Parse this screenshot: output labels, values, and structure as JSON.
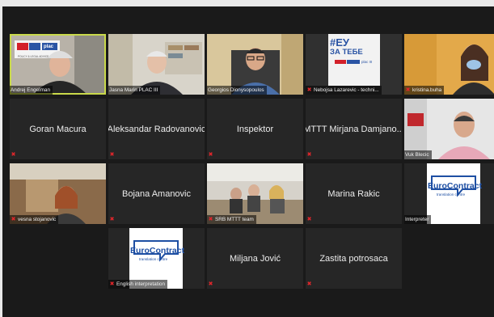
{
  "meeting": {
    "tiles": [
      {
        "name": "Andrej Engelman",
        "muted": false,
        "active": true
      },
      {
        "name": "Jasna Marin PLAC III",
        "muted": false
      },
      {
        "name": "Georgios Dionysopoulos",
        "muted": false
      },
      {
        "name": "Nebojsa Lazarevic - techni...",
        "muted": true
      },
      {
        "name": "kristina.buha",
        "muted": true
      },
      {
        "name": "Goran Macura",
        "muted": true
      },
      {
        "name": "Aleksandar Radovanovic",
        "muted": true
      },
      {
        "name": "Inspektor",
        "muted": true
      },
      {
        "name": "MTTT Mirjana Damjano...",
        "muted": true
      },
      {
        "name": "Vuk Blecic",
        "muted": false
      },
      {
        "name": "vesna stojanovic",
        "muted": true
      },
      {
        "name": "Bojana Amanovic",
        "muted": true
      },
      {
        "name": "SRB MTTT team",
        "muted": true
      },
      {
        "name": "Marina Rakic",
        "muted": true
      },
      {
        "name": "Interpreter",
        "muted": false
      },
      {
        "name": "English interpretation",
        "muted": true
      },
      {
        "name": "Miljana Jović",
        "muted": true
      },
      {
        "name": "Zastita potrosaca",
        "muted": true
      }
    ],
    "slogan": {
      "line1": "#ЕУ",
      "line2": "ЗА ТЕБЕ",
      "badge": "plac III"
    },
    "logo_brand": "plac",
    "logo_subtitle": "POLICY & LEGAL ADVICE",
    "euro_logo": {
      "title": "EuroContract",
      "subtitle": "translation centre"
    },
    "colors": {
      "active_border": "#c9d94a",
      "muted_icon": "#e2262b",
      "euro_blue": "#1e4fa3"
    }
  }
}
